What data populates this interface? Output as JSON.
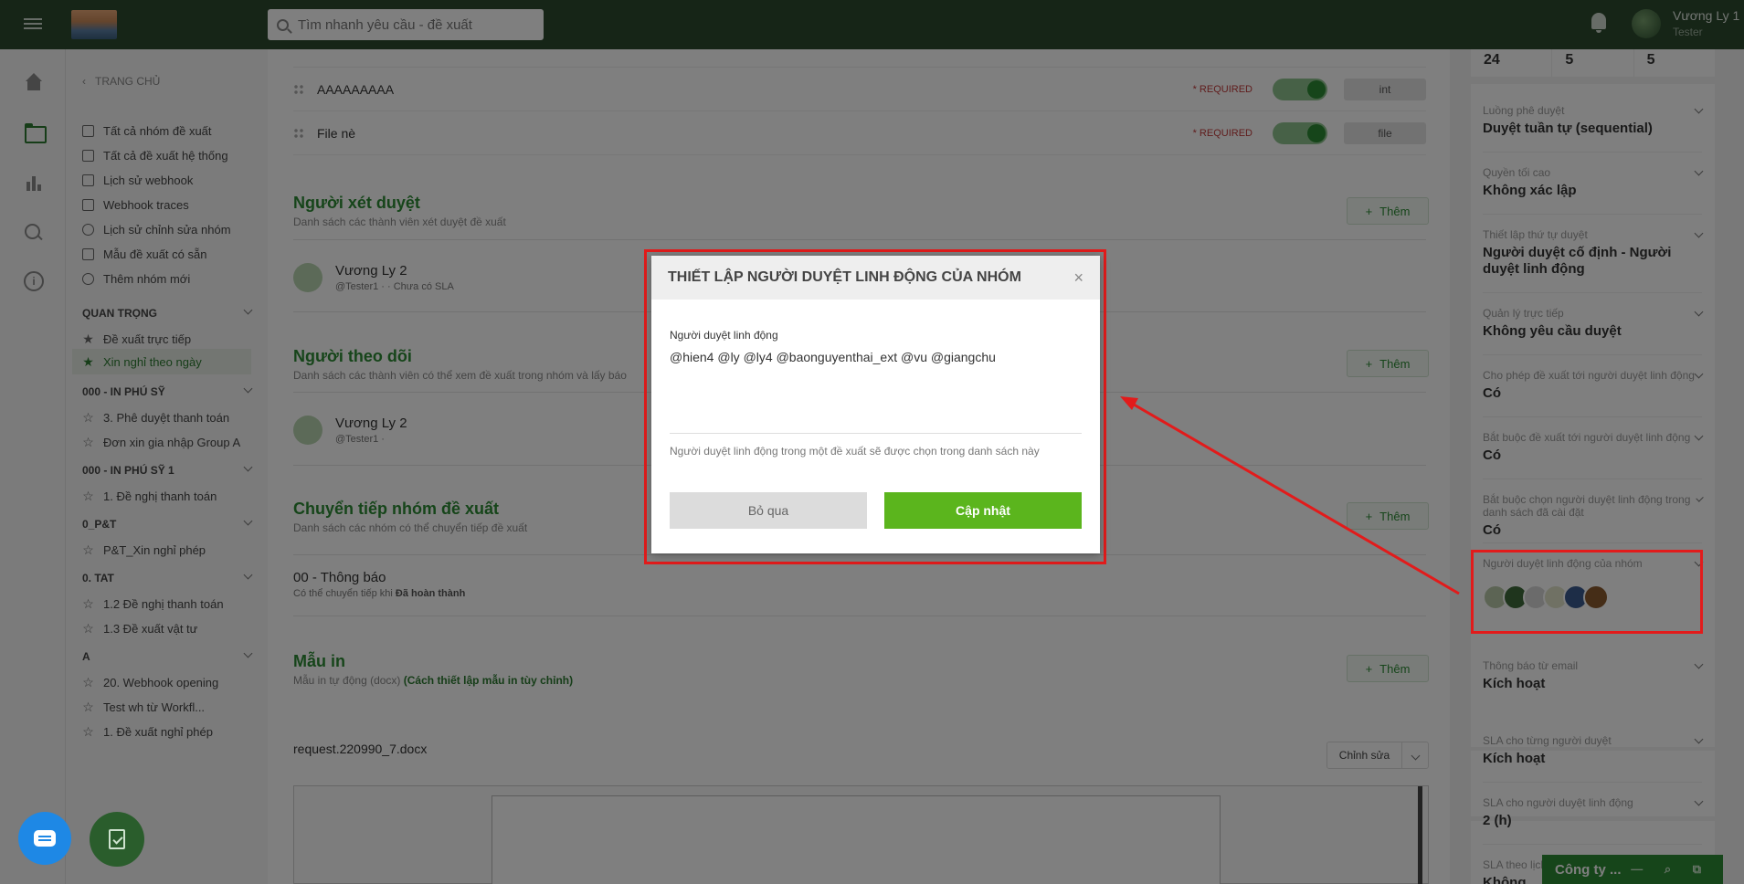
{
  "topbar": {
    "search_placeholder": "Tìm nhanh yêu cầu - đề xuất",
    "user_name": "Vương Ly 1",
    "user_role": "Tester"
  },
  "nav": {
    "back": "TRANG CHỦ",
    "items": [
      {
        "label": "Tất cả nhóm đề xuất",
        "icon": "grid-icon"
      },
      {
        "label": "Tất cả đề xuất hệ thống",
        "icon": "copy-icon"
      },
      {
        "label": "Lịch sử webhook",
        "icon": "document-icon"
      },
      {
        "label": "Webhook traces",
        "icon": "document-icon"
      },
      {
        "label": "Lịch sử chỉnh sửa nhóm",
        "icon": "clock-icon"
      },
      {
        "label": "Mẫu đề xuất có sẵn",
        "icon": "bookmark-icon"
      },
      {
        "label": "Thêm nhóm mới",
        "icon": "plus-circle-icon"
      }
    ],
    "sections": [
      {
        "title": "QUAN TRỌNG",
        "items": [
          "Đề xuất trực tiếp",
          "Xin nghỉ theo ngày"
        ]
      },
      {
        "title": "000 - IN PHÚ SỸ",
        "items": [
          "3. Phê duyệt thanh toán",
          "Đơn xin gia nhập Group A"
        ]
      },
      {
        "title": "000 - IN PHÚ SỸ 1",
        "items": [
          "1. Đề nghị thanh toán"
        ]
      },
      {
        "title": "0_P&T",
        "items": [
          "P&T_Xin nghỉ phép"
        ]
      },
      {
        "title": "0. TAT",
        "items": [
          "1.2 Đề nghị thanh toán",
          "1.3 Đề xuất vật tư"
        ]
      },
      {
        "title": "A",
        "items": [
          "20. Webhook opening",
          "Test wh từ Workfl...",
          "1. Đề xuất nghỉ phép"
        ]
      }
    ]
  },
  "main": {
    "fields": [
      {
        "name": "AAAAAAAAA",
        "required": "* REQUIRED",
        "type": "int"
      },
      {
        "name": "File nè",
        "required": "* REQUIRED",
        "type": "file"
      }
    ],
    "reviewers": {
      "title": "Người xét duyệt",
      "desc": "Danh sách các thành viên xét duyệt đề xuất",
      "add": "Thêm",
      "person_name": "Vương Ly 2",
      "person_sub": "@Tester1 · · Chưa có SLA"
    },
    "followers": {
      "title": "Người theo dõi",
      "desc": "Danh sách các thành viên có thể xem đề xuất trong nhóm và lấy báo",
      "add": "Thêm",
      "person_name": "Vương Ly 2",
      "person_sub": "@Tester1 ·"
    },
    "forward": {
      "title": "Chuyển tiếp nhóm đề xuất",
      "desc": "Danh sách các nhóm có thể chuyển tiếp đề xuất",
      "add": "Thêm",
      "item_name": "00 - Thông báo",
      "item_sub_prefix": "Có thể chuyển tiếp khi",
      "item_sub_bold": "Đã hoàn thành"
    },
    "print": {
      "title": "Mẫu in",
      "desc_prefix": "Mẫu in tự động (docx)",
      "desc_link": "(Cách thiết lập mẫu in tùy chỉnh)",
      "add": "Thêm",
      "file": "request.220990_7.docx",
      "edit": "Chỉnh sửa"
    }
  },
  "right": {
    "stats": [
      "24",
      "5",
      "5"
    ],
    "rows": [
      {
        "label": "Luồng phê duyệt",
        "value": "Duyệt tuần tự (sequential)"
      },
      {
        "label": "Quyền tối cao",
        "value": "Không xác lập"
      },
      {
        "label": "Thiết lập thứ tự duyệt",
        "value": "Người duyệt cố định - Người duyệt linh động"
      },
      {
        "label": "Quản lý trực tiếp",
        "value": "Không yêu cầu duyệt"
      },
      {
        "label": "Cho phép đề xuất tới người duyệt linh động",
        "value": "Có"
      },
      {
        "label": "Bắt buộc đề xuất tới người duyệt linh động",
        "value": "Có"
      },
      {
        "label": "Bắt buộc chọn người duyệt linh động trong danh sách đã cài đặt",
        "value": "Có"
      },
      {
        "label": "Người duyệt linh động của nhóm",
        "value": ""
      },
      {
        "label": "Thông báo từ email",
        "value": "Kích hoạt"
      },
      {
        "label": "SLA cho từng người duyệt",
        "value": "Kích hoạt"
      },
      {
        "label": "SLA cho người duyệt linh động",
        "value": "2 (h)"
      },
      {
        "label": "SLA theo lịch",
        "value": "Không"
      }
    ],
    "avatar_colors": [
      "#b9c9a8",
      "#3f6a3a",
      "#d7d7d7",
      "#e1e3c9",
      "#3a5b8f",
      "#8a5a2f"
    ]
  },
  "chat": {
    "label": "Công ty ..."
  },
  "modal": {
    "title": "THIẾT LẬP NGƯỜI DUYỆT LINH ĐỘNG CỦA NHÓM",
    "label": "Người duyệt linh động",
    "value": "@hien4 @ly @ly4 @baonguyenthai_ext @vu @giangchu",
    "hint": "Người duyệt linh động trong một đề xuất sẽ được chọn trong danh sách này",
    "cancel": "Bỏ qua",
    "ok": "Cập nhật"
  },
  "colors": {
    "brand_green": "#2c8a34",
    "annotation_red": "#e21b1b",
    "ok_button": "#5bb51d"
  }
}
